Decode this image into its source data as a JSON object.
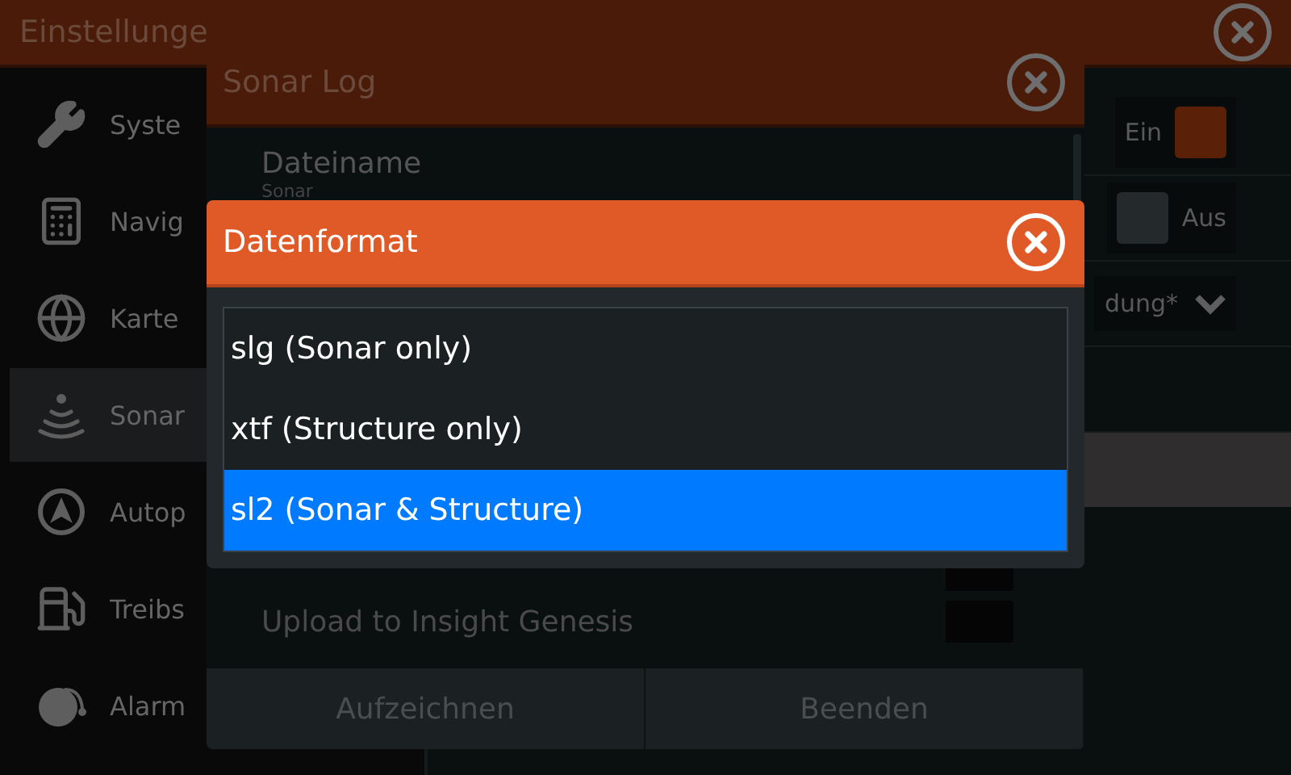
{
  "settings": {
    "title": "Einstellunge",
    "sidebar": {
      "items": [
        {
          "label": "Syste",
          "selected": false
        },
        {
          "label": "Navig",
          "selected": false
        },
        {
          "label": "Karte",
          "selected": false
        },
        {
          "label": "Sonar",
          "selected": true
        },
        {
          "label": "Autop",
          "selected": false
        },
        {
          "label": "Treibs",
          "selected": false
        },
        {
          "label": "Alarm",
          "selected": false
        }
      ]
    },
    "rows": [
      {
        "kind": "toggle",
        "label": "Ein",
        "on": true
      },
      {
        "kind": "toggle",
        "label": "Aus",
        "on": false
      },
      {
        "kind": "dropdown",
        "value": "dung*"
      },
      {
        "kind": "blank"
      },
      {
        "kind": "bar"
      }
    ]
  },
  "sonar_log": {
    "title": "Sonar Log",
    "filename": {
      "label": "Dateiname",
      "value": "Sonar"
    },
    "options": [
      {
        "kind": "checkbox",
        "checked": false
      },
      {
        "kind": "checkbox",
        "label": "Upload to Insight Genesis",
        "checked": false
      }
    ],
    "buttons": [
      "Aufzeichnen",
      "Beenden"
    ]
  },
  "data_format": {
    "title": "Datenformat",
    "options": [
      {
        "label": "slg (Sonar only)",
        "selected": false
      },
      {
        "label": "xtf (Structure only)",
        "selected": false
      },
      {
        "label": "sl2 (Sonar & Structure)",
        "selected": true
      }
    ]
  }
}
